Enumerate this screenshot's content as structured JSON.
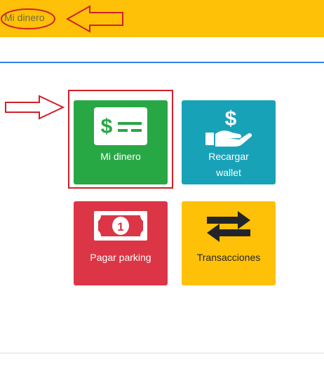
{
  "header": {
    "title": "Mi dinero",
    "background": "#ffc107"
  },
  "annotations": {
    "color": "#d0202a",
    "items": [
      "header-title-ellipse",
      "header-arrow",
      "tile-arrow",
      "tile-highlight-box"
    ]
  },
  "tiles": [
    {
      "label": "Mi dinero",
      "icon": "money-card-icon",
      "color": "#28a745"
    },
    {
      "label_line1": "Recargar",
      "label_line2": "wallet",
      "icon": "hand-dollar-icon",
      "color": "#17a2b8"
    },
    {
      "label": "Pagar parking",
      "icon": "banknote-icon",
      "color": "#dc3545"
    },
    {
      "label": "Transacciones",
      "icon": "exchange-arrows-icon",
      "color": "#ffc107"
    }
  ]
}
